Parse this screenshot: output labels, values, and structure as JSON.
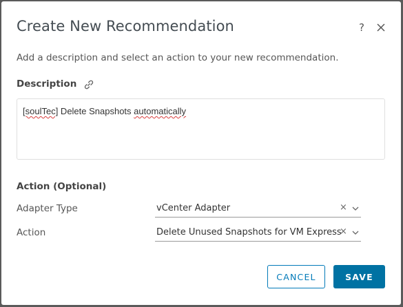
{
  "dialog": {
    "title": "Create New Recommendation",
    "help_label": "?",
    "subtitle": "Add a description and select an action to your new recommendation."
  },
  "description": {
    "label": "Description",
    "value_prefix": "[soulTec]",
    "value_middle": " Delete Snapshots ",
    "value_suffix": "automatically"
  },
  "action_section": {
    "label": "Action (Optional)",
    "adapter_type": {
      "label": "Adapter Type",
      "value": "vCenter Adapter"
    },
    "action": {
      "label": "Action",
      "value": "Delete Unused Snapshots for VM Express"
    },
    "clear_glyph": "×"
  },
  "buttons": {
    "cancel": "CANCEL",
    "save": "SAVE"
  },
  "colors": {
    "primary": "#0072a3",
    "outline": "#0079b8",
    "spellcheck": "#d93b3b"
  }
}
